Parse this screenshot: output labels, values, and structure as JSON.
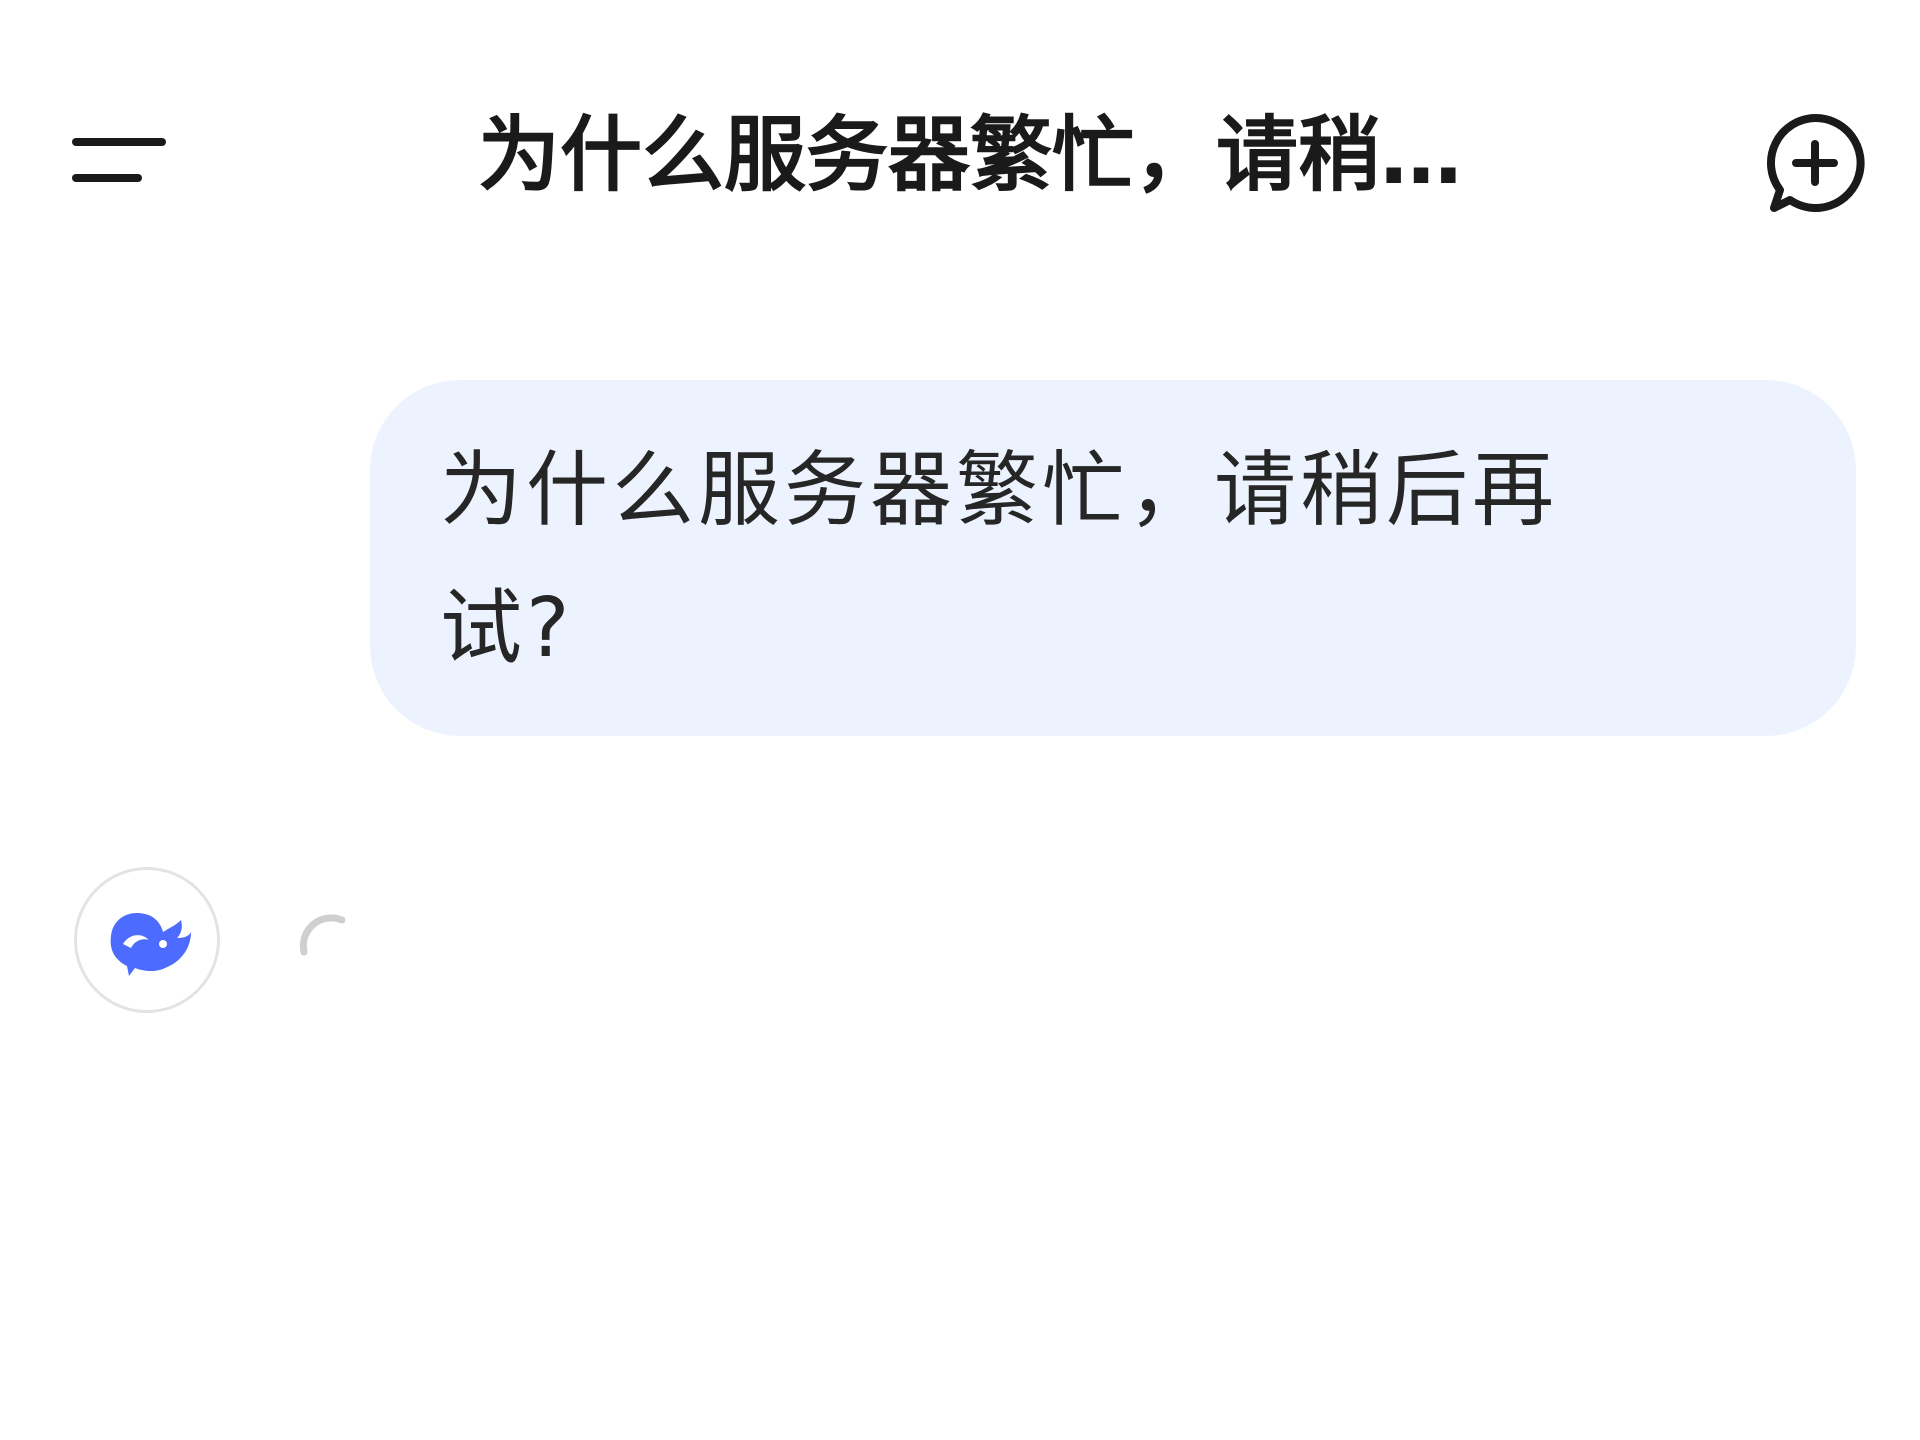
{
  "header": {
    "title": "为什么服务器繁忙，请稍…",
    "menu_icon": "menu-icon",
    "new_chat_icon": "new-chat-icon"
  },
  "conversation": {
    "user_message": "为什么服务器繁忙，请稍后再试?",
    "assistant_avatar_icon": "whale-logo-icon",
    "assistant_status_icon": "loading-spinner-icon"
  },
  "colors": {
    "bubble_background": "#edf3fe",
    "brand_blue": "#4d6bfe",
    "text": "#1a1a1a"
  }
}
